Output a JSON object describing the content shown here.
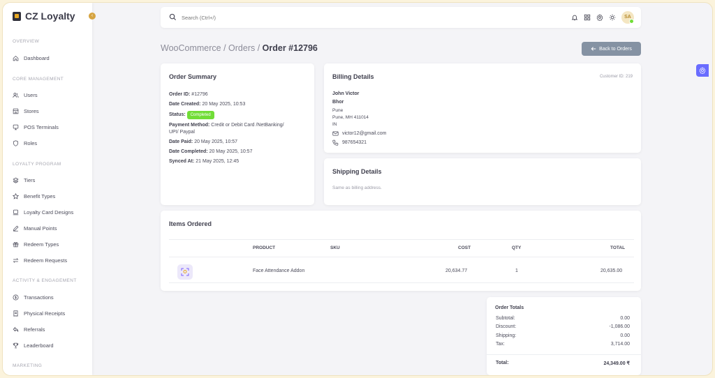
{
  "app": {
    "brand": "CZ Loyalty"
  },
  "sidebar": {
    "sections": [
      {
        "title": "OVERVIEW",
        "items": [
          {
            "label": "Dashboard",
            "icon": "home-icon"
          }
        ]
      },
      {
        "title": "CORE MANAGEMENT",
        "items": [
          {
            "label": "Users",
            "icon": "users-icon"
          },
          {
            "label": "Stores",
            "icon": "store-icon"
          },
          {
            "label": "POS Terminals",
            "icon": "pos-terminal-icon"
          },
          {
            "label": "Roles",
            "icon": "shield-icon"
          }
        ]
      },
      {
        "title": "LOYALTY PROGRAM",
        "items": [
          {
            "label": "Tiers",
            "icon": "layers-icon"
          },
          {
            "label": "Benefit Types",
            "icon": "star-icon"
          },
          {
            "label": "Loyalty Card Designs",
            "icon": "card-icon"
          },
          {
            "label": "Manual Points",
            "icon": "edit-icon"
          },
          {
            "label": "Redeem Types",
            "icon": "gift-icon"
          },
          {
            "label": "Redeem Requests",
            "icon": "swap-icon"
          }
        ]
      },
      {
        "title": "ACTIVITY & ENGAGEMENT",
        "items": [
          {
            "label": "Transactions",
            "icon": "dollar-circle-icon"
          },
          {
            "label": "Physical Receipts",
            "icon": "receipt-icon"
          },
          {
            "label": "Referrals",
            "icon": "share-icon"
          },
          {
            "label": "Leaderboard",
            "icon": "trophy-icon"
          }
        ]
      },
      {
        "title": "MARKETING",
        "items": []
      }
    ]
  },
  "topbar": {
    "search_placeholder": "Search (Ctrl+/)",
    "avatar_initials": "SA"
  },
  "breadcrumb": {
    "part1": "WooCommerce",
    "sep1": " / ",
    "part2": "Orders",
    "sep2": " / ",
    "current": "Order #12796"
  },
  "back_button": "Back to Orders",
  "order_summary": {
    "title": "Order Summary",
    "order_id_label": "Order ID:",
    "order_id": "#12796",
    "date_created_label": "Date Created:",
    "date_created": "20 May 2025, 10:53",
    "status_label": "Status:",
    "status": "Completed",
    "payment_label": "Payment Method:",
    "payment_line1": "Credit or Debit Card /NetBanking/",
    "payment_line2": "UPI/ Paypal",
    "date_paid_label": "Date Paid:",
    "date_paid": "20 May 2025, 10:57",
    "date_completed_label": "Date Completed:",
    "date_completed": "20 May 2025, 10:57",
    "synced_label": "Synced At:",
    "synced": "21 May 2025, 12:45"
  },
  "billing": {
    "title": "Billing Details",
    "customer_id": "Customer ID: 219",
    "first_name": "John Victor",
    "last_name": "Bhor",
    "city": "Pune",
    "city_line": "Pune, MH 411014",
    "country": "IN",
    "email": "victor12@gmail.com",
    "phone": "987654321"
  },
  "shipping": {
    "title": "Shipping Details",
    "note": "Same as billing address."
  },
  "items": {
    "title": "Items Ordered",
    "headers": {
      "product": "PRODUCT",
      "sku": "SKU",
      "cost": "COST",
      "qty": "QTY",
      "total": "TOTAL"
    },
    "rows": [
      {
        "product": "Face Attendance Addon",
        "sku": "",
        "cost": "20,634.77",
        "qty": "1",
        "total": "20,635.00"
      }
    ]
  },
  "totals": {
    "title": "Order Totals",
    "subtotal_label": "Subtotal:",
    "subtotal": "0.00",
    "discount_label": "Discount:",
    "discount": "-1,086.00",
    "shipping_label": "Shipping:",
    "shipping": "0.00",
    "tax_label": "Tax:",
    "tax": "3,714.00",
    "total_label": "Total:",
    "total": "24,349.00 ₹"
  },
  "colors": {
    "accent": "#696cff",
    "success": "#71dd37",
    "brand_gold": "#d6a441",
    "secondary_button": "#8592a3"
  }
}
